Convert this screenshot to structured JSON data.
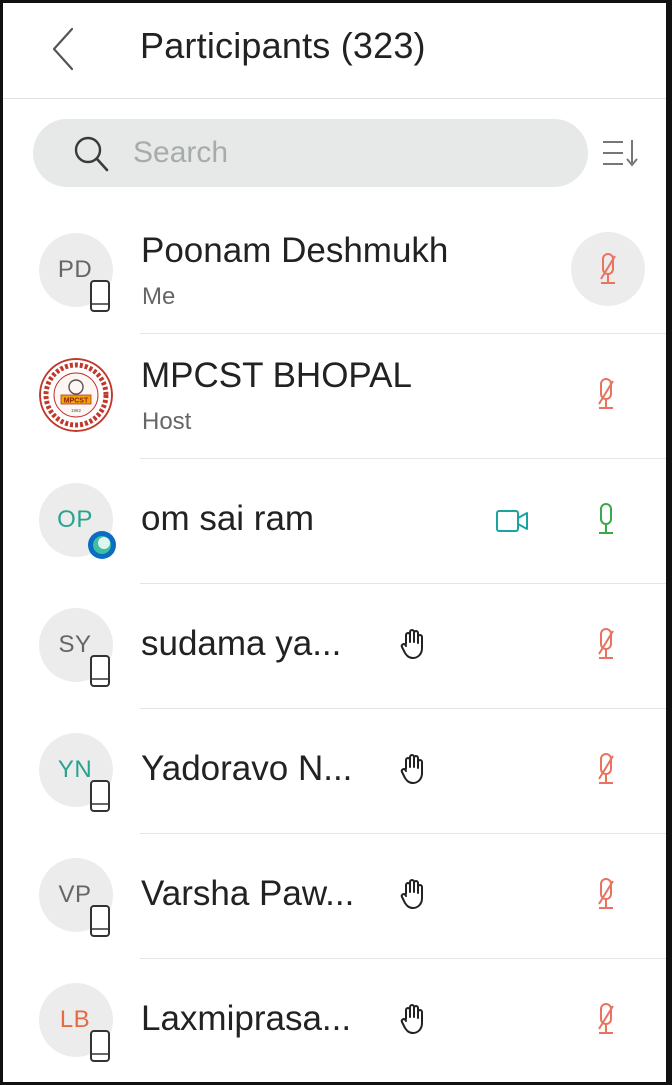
{
  "header": {
    "title": "Participants (323)"
  },
  "search": {
    "placeholder": "Search",
    "value": ""
  },
  "colors": {
    "muted_mic": "#e8735f",
    "active_mic": "#3aa84a",
    "video": "#1aa3a3",
    "teal_initials": "#29a38f",
    "orange_initials": "#e86a3f"
  },
  "participants": [
    {
      "initials": "PD",
      "name": "Poonam Deshmukh",
      "role": "Me",
      "device": "phone",
      "hand_raised": false,
      "video": false,
      "mic": "muted"
    },
    {
      "initials": "",
      "name": "MPCST BHOPAL",
      "role": "Host",
      "avatar": "logo",
      "logo_text": "MPCST",
      "logo_year": "1982",
      "device": "none",
      "hand_raised": false,
      "video": false,
      "mic": "muted"
    },
    {
      "initials": "OP",
      "name": "om sai ram",
      "role": "",
      "device": "webex-app",
      "hand_raised": false,
      "video": true,
      "mic": "active"
    },
    {
      "initials": "SY",
      "name": "sudama ya...",
      "role": "",
      "device": "phone",
      "hand_raised": true,
      "video": false,
      "mic": "muted"
    },
    {
      "initials": "YN",
      "name": "Yadoravo N...",
      "role": "",
      "device": "phone",
      "hand_raised": true,
      "video": false,
      "mic": "muted"
    },
    {
      "initials": "VP",
      "name": "Varsha Paw...",
      "role": "",
      "device": "phone",
      "hand_raised": true,
      "video": false,
      "mic": "muted"
    },
    {
      "initials": "LB",
      "name": "Laxmiprasa...",
      "role": "",
      "device": "phone",
      "hand_raised": true,
      "video": false,
      "mic": "muted"
    }
  ]
}
